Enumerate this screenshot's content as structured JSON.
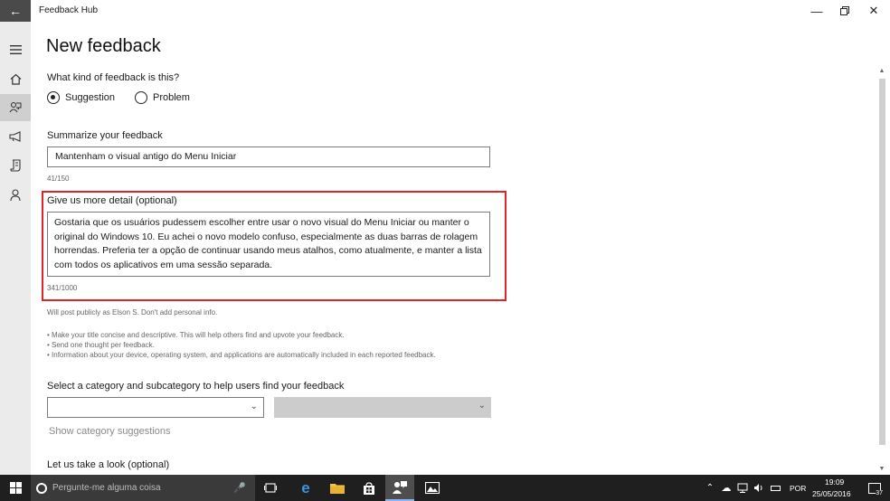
{
  "window": {
    "app_title": "Feedback Hub"
  },
  "nav": {
    "items": [
      "menu-icon",
      "home-icon",
      "feedback-icon",
      "announcements-icon",
      "quests-icon",
      "profile-icon"
    ]
  },
  "page": {
    "title": "New feedback",
    "kind_question": "What kind of feedback is this?",
    "options": [
      "Suggestion",
      "Problem"
    ],
    "selected_option": "Suggestion",
    "summary_label": "Summarize your feedback",
    "summary_value": "Mantenham o visual antigo do Menu Iniciar",
    "summary_count": "41/150",
    "detail_label": "Give us more detail (optional)",
    "detail_value": "Gostaria que os usuários pudessem escolher entre usar o novo visual do Menu Iniciar ou manter o original do Windows 10. Eu achei o novo modelo confuso, especialmente as duas barras de rolagem horrendas.  Preferia ter a opção de continuar usando meus atalhos, como atualmente, e manter a lista com todos os aplicativos em uma sessão separada.",
    "detail_count": "341/1000",
    "public_note": "Will post publicly as Elson S. Don't add personal info.",
    "tips": [
      "• Make your title concise and descriptive. This will help others find and upvote your feedback.",
      "• Send one thought per feedback.",
      "• Information about your device, operating system, and applications are automatically included in each reported feedback."
    ],
    "category_label": "Select a category and subcategory to help users find your feedback",
    "category_link": "Show category suggestions",
    "look_label": "Let us take a look (optional)"
  },
  "taskbar": {
    "search_placeholder": "Pergunte-me alguma coisa",
    "language": "POR",
    "time": "19:09",
    "date": "25/05/2016",
    "notifications": "37"
  },
  "colors": {
    "highlight": "#e0242a",
    "nav_bg": "#ebebeb",
    "taskbar_bg": "#1f1f1f"
  }
}
